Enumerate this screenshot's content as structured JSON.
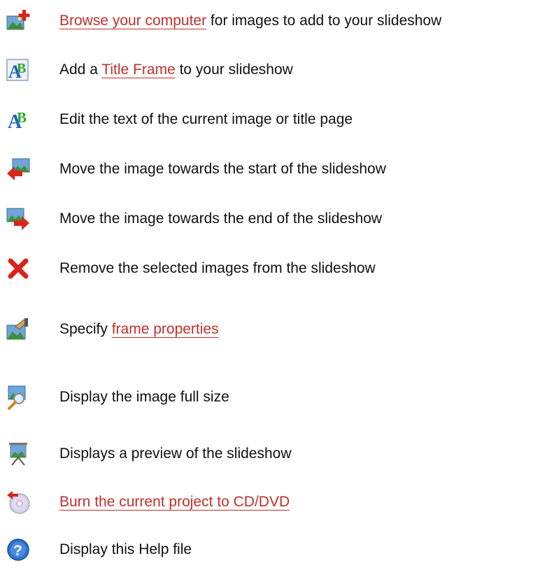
{
  "colors": {
    "link": "#c0302c",
    "text": "#111111",
    "background": "#ffffff"
  },
  "items": [
    {
      "icon": "add-images-icon",
      "link": "Browse your computer",
      "after": " for images to add to your slideshow"
    },
    {
      "icon": "title-frame-icon",
      "before": "Add a ",
      "link": "Title Frame",
      "after": " to your slideshow"
    },
    {
      "icon": "edit-text-icon",
      "text": "Edit the text of the current image or title page"
    },
    {
      "icon": "move-left-icon",
      "text": "Move the image towards the start of the slideshow"
    },
    {
      "icon": "move-right-icon",
      "text": "Move the image towards the end of the slideshow"
    },
    {
      "icon": "remove-icon",
      "text": "Remove the selected images from the slideshow"
    },
    {
      "icon": "frame-properties-icon",
      "before": "Specify ",
      "link": "frame properties"
    },
    {
      "icon": "zoom-image-icon",
      "text": "Display the image full size"
    },
    {
      "icon": "preview-slideshow-icon",
      "text": "Displays a preview of the slideshow"
    },
    {
      "icon": "burn-disc-icon",
      "link": "Burn the current project to CD/DVD"
    },
    {
      "icon": "help-icon",
      "text": "Display this Help file"
    }
  ]
}
